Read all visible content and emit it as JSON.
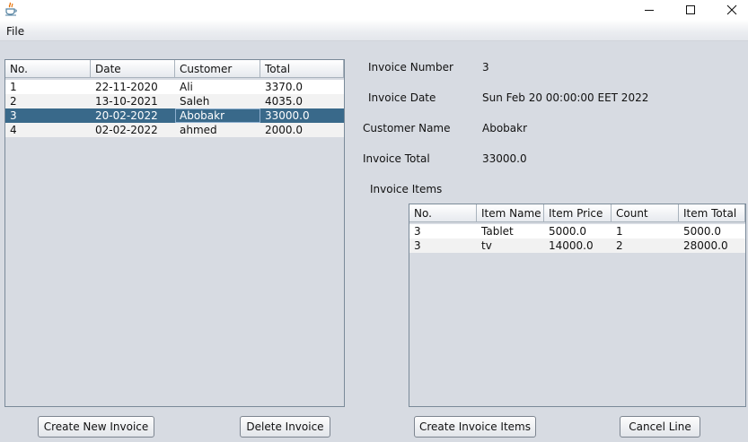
{
  "menu": {
    "file": "File"
  },
  "invoices_table": {
    "headers": [
      "No.",
      "Date",
      "Customer",
      "Total"
    ],
    "rows": [
      [
        "1",
        "22-11-2020",
        "Ali",
        "3370.0"
      ],
      [
        "2",
        "13-10-2021",
        "Saleh",
        "4035.0"
      ],
      [
        "3",
        "20-02-2022",
        "Abobakr",
        "33000.0"
      ],
      [
        "4",
        "02-02-2022",
        "ahmed",
        "2000.0"
      ]
    ],
    "selected_row": 2
  },
  "details": {
    "invoice_number_label": "Invoice Number",
    "invoice_number_value": "3",
    "invoice_date_label": "Invoice Date",
    "invoice_date_value": "Sun Feb 20 00:00:00 EET 2022",
    "customer_name_label": "Customer Name",
    "customer_name_value": "Abobakr",
    "invoice_total_label": "Invoice Total",
    "invoice_total_value": "33000.0",
    "invoice_items_label": "Invoice Items"
  },
  "items_table": {
    "headers": [
      "No.",
      "Item Name",
      "Item Price",
      "Count",
      "Item Total"
    ],
    "rows": [
      [
        "3",
        "Tablet",
        "5000.0",
        "1",
        "5000.0"
      ],
      [
        "3",
        "tv",
        "14000.0",
        "2",
        "28000.0"
      ]
    ]
  },
  "buttons": {
    "create_invoice": "Create New Invoice",
    "delete_invoice": "Delete Invoice",
    "create_items": "Create Invoice Items",
    "cancel_line": "Cancel Line"
  },
  "icons": {
    "app": "java-cup-icon",
    "minimize": "minimize-icon",
    "maximize": "maximize-icon",
    "close": "close-icon"
  }
}
